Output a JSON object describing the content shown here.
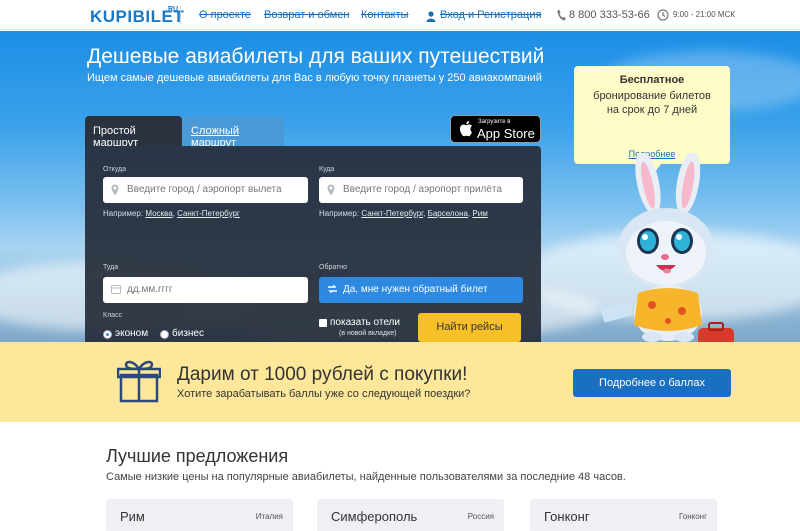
{
  "header": {
    "logo": "KUPIBILET",
    "logo_suffix": "RU",
    "nav": [
      "О проекте",
      "Возврат и обмен",
      "Контакты",
      "Вход и Регистрация"
    ],
    "phone": "8 800 333-53-66",
    "hours": "9:00 - 21:00 МСК"
  },
  "hero": {
    "title": "Дешевые авиабилеты для ваших путешествий",
    "subtitle": "Ищем самые дешевые авиабилеты для Вас в любую точку планеты у 250 авиакомпаний"
  },
  "search": {
    "tabs": [
      "Простой маршрут",
      "Сложный маршрут"
    ],
    "appstore_small": "Загрузите в",
    "appstore_big": "App Store",
    "from_label": "Откуда",
    "from_placeholder": "Введите город / аэропорт вылета",
    "from_hint_prefix": "Например:",
    "from_hint_cities": [
      "Москва",
      "Санкт-Петербург"
    ],
    "to_label": "Куда",
    "to_placeholder": "Введите город / аэропорт прилёта",
    "to_hint_prefix": "Например:",
    "to_hint_cities": [
      "Санкт-Петербург",
      "Барселона",
      "Рим"
    ],
    "date_label": "Туда",
    "date_placeholder": "дд.мм.гггг",
    "return_label": "Обратно",
    "return_button": "Да, мне нужен обратный билет",
    "class_label": "Класс",
    "class_options": [
      "эконом",
      "бизнес"
    ],
    "class_selected": "эконом",
    "hotels_label": "показать отели",
    "hotels_sub": "(в новой вкладке)",
    "hotels_checked": false,
    "find_button": "Найти рейсы"
  },
  "promo": {
    "title": "Бесплатное",
    "text_line1": "бронирование билетов",
    "text_line2": "на срок до 7 дней",
    "link": "Подробнее"
  },
  "bonus": {
    "title": "Дарим от 1000 рублей с покупки!",
    "subtitle": "Хотите зарабатывать баллы уже со следующей поездки?",
    "button": "Подробнее о баллах"
  },
  "offers": {
    "title": "Лучшие предложения",
    "subtitle": "Самые низкие цены на популярные авиабилеты, найденные пользователями за последние 48 часов.",
    "items": [
      {
        "city": "Рим",
        "country": "Италия"
      },
      {
        "city": "Симферополь",
        "country": "Россия"
      },
      {
        "city": "Гонконг",
        "country": "Гонконг"
      }
    ]
  },
  "colors": {
    "brand_blue": "#1a78c2",
    "link_blue": "#1a6fb8",
    "search_button": "#f7c028",
    "bonus_bg": "#fde79a",
    "card_bg": "#262d3a"
  }
}
